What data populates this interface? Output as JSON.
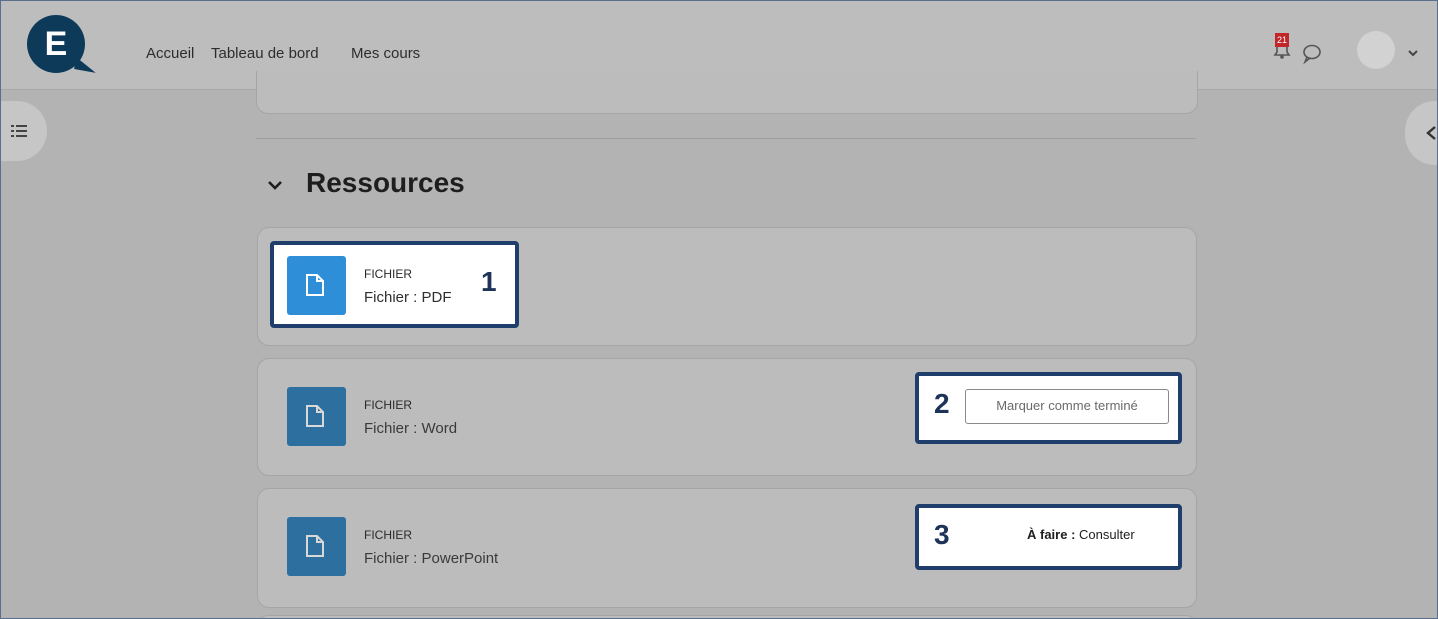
{
  "nav": {
    "logo_letter": "E",
    "links": [
      "Accueil",
      "Tableau de bord",
      "Mes cours"
    ],
    "notification_count": "21"
  },
  "section": {
    "title": "Ressources"
  },
  "resources": [
    {
      "type": "FICHIER",
      "name": "Fichier : PDF",
      "callout": "1"
    },
    {
      "type": "FICHIER",
      "name": "Fichier : Word",
      "callout": "2",
      "action_label": "Marquer comme terminé"
    },
    {
      "type": "FICHIER",
      "name": "Fichier : PowerPoint",
      "callout": "3",
      "todo_prefix": "À faire :",
      "todo_text": " Consulter"
    }
  ],
  "colors": {
    "accent": "#203e6b",
    "file_icon": "#2d6f9e",
    "file_icon_highlight": "#2e8fd8",
    "badge": "#c0262a"
  }
}
